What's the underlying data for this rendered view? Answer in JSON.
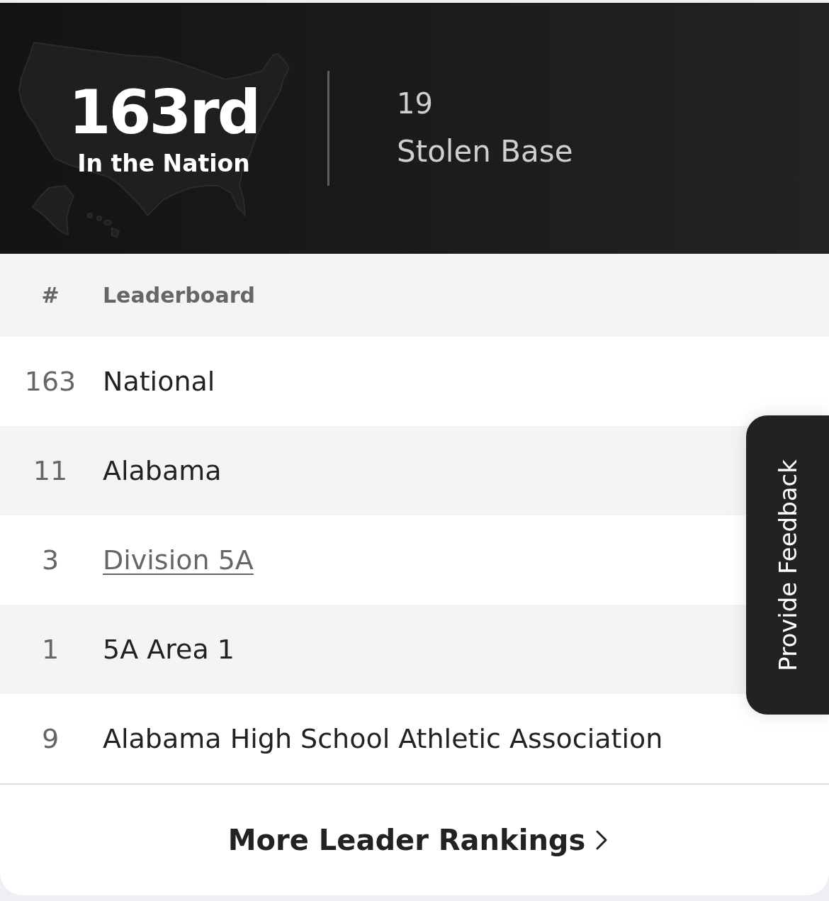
{
  "header": {
    "rank": "163rd",
    "rank_label": "In the Nation",
    "stat_value": "19",
    "stat_label": "Stolen Base"
  },
  "table": {
    "columns": [
      "#",
      "Leaderboard"
    ],
    "rows": [
      {
        "rank": "163",
        "name": "National",
        "kind": "text"
      },
      {
        "rank": "11",
        "name": "Alabama",
        "kind": "text"
      },
      {
        "rank": "3",
        "name": "Division 5A",
        "kind": "link"
      },
      {
        "rank": "1",
        "name": "5A Area 1",
        "kind": "text"
      },
      {
        "rank": "9",
        "name": "Alabama High School Athletic Association",
        "kind": "text"
      }
    ]
  },
  "footer_link": {
    "label": "More Leader Rankings"
  },
  "feedback_tab": {
    "label": "Provide Feedback"
  }
}
